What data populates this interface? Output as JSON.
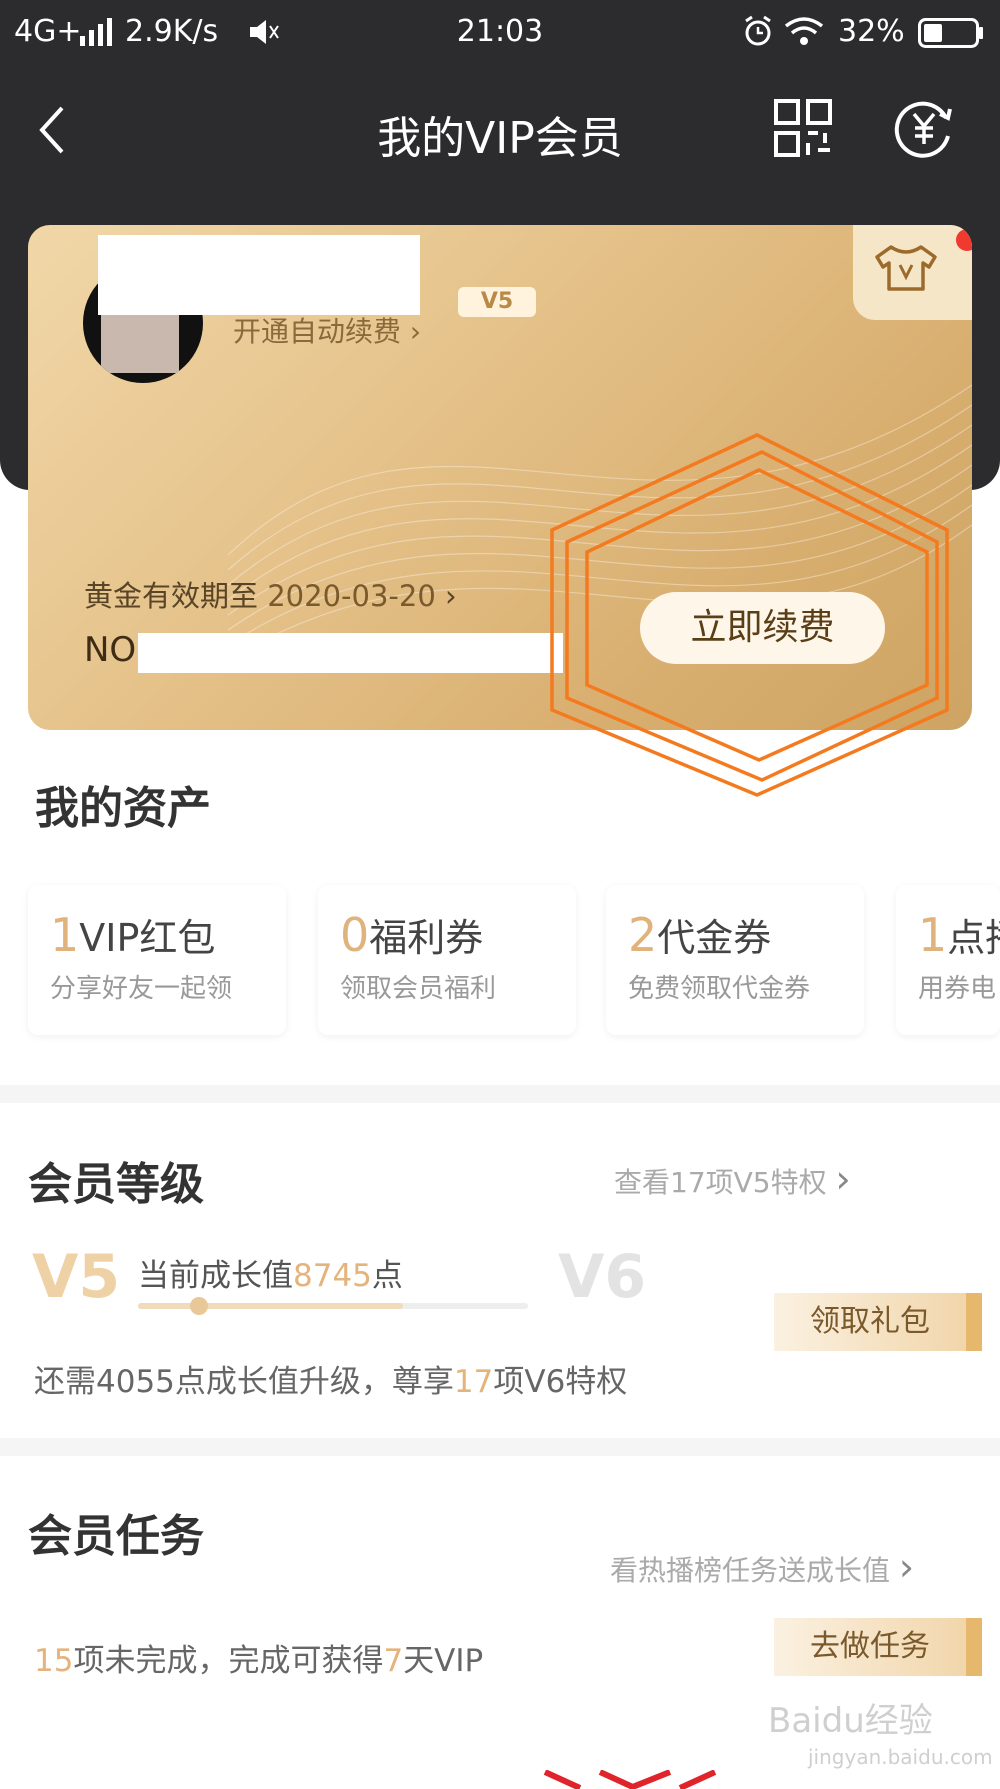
{
  "status_bar": {
    "network": "4G+",
    "speed": "2.9K/s",
    "time": "21:03",
    "battery": "32%"
  },
  "nav": {
    "title": "我的VIP会员"
  },
  "card": {
    "auto_renew": "开通自动续费",
    "badge": "V5",
    "expiry_label": "黄金有效期至",
    "expiry_date": "2020-03-20",
    "card_no_prefix": "NO",
    "renew_button": "立即续费"
  },
  "assets": {
    "title": "我的资产",
    "items": [
      {
        "count": "1",
        "label": "VIP红包",
        "desc": "分享好友一起领"
      },
      {
        "count": "0",
        "label": "福利券",
        "desc": "领取会员福利"
      },
      {
        "count": "2",
        "label": "代金券",
        "desc": "免费领取代金券"
      },
      {
        "count": "1",
        "label": "点播",
        "desc": "用券电"
      }
    ]
  },
  "level": {
    "title": "会员等级",
    "link": "查看17项V5特权",
    "current_level": "V5",
    "next_level": "V6",
    "growth_prefix": "当前成长值",
    "growth_value": "8745",
    "growth_suffix": "点",
    "gift_button": "领取礼包",
    "upgrade_part1": "还需4055点成长值升级，尊享",
    "upgrade_count": "17",
    "upgrade_part2": "项V6特权"
  },
  "tasks": {
    "title": "会员任务",
    "link": "看热播榜任务送成长值",
    "incomplete_count": "15",
    "desc_part1": "项未完成，完成可获得",
    "desc_days": "7",
    "desc_part2": "天VIP",
    "button": "去做任务"
  },
  "watermark": {
    "brand": "Baidu经验",
    "url": "jingyan.baidu.com"
  },
  "colors": {
    "header_bg": "#2c2c2e",
    "gold": "#e4b47c",
    "annotation": "#f47a20"
  }
}
